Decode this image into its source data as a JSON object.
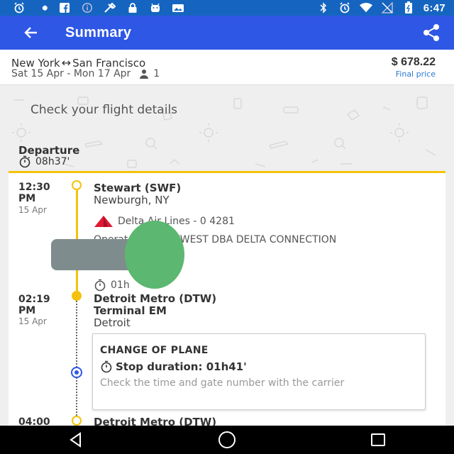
{
  "status_bar": {
    "time": "6:47",
    "left_icons": [
      "alarm-icon",
      "wrench-icon",
      "facebook-icon",
      "info-icon",
      "tools-icon",
      "lock-icon",
      "android-icon",
      "photo-icon"
    ],
    "right_icons": [
      "bluetooth-icon",
      "alarm-icon",
      "wifi-icon",
      "signal-off-icon",
      "battery-icon"
    ]
  },
  "app_bar": {
    "title": "Summary",
    "color": "#2f57e6"
  },
  "trip": {
    "origin": "New York",
    "destination": "San Francisco",
    "route_separator": "↔",
    "dates": "Sat 15 Apr - Mon 17 Apr",
    "passengers": "1",
    "price": "$ 678.22",
    "price_note": "Final price"
  },
  "content": {
    "check_title": "Check your flight details",
    "departure_label": "Departure",
    "departure_duration": "08h37'"
  },
  "segment1": {
    "dep_time_line1": "12:30",
    "dep_time_line2": "PM",
    "dep_date": "15 Apr",
    "dep_airport": "Stewart (SWF)",
    "dep_city": "Newburgh, NY",
    "airline": "Delta Air Lines - 0 4281",
    "operated_by": "Operated by: SKYWEST DBA DELTA CONNECTION",
    "duration": "01h",
    "arr_time_line1": "02:19",
    "arr_time_line2": "PM",
    "arr_date": "15 Apr",
    "arr_airport": "Detroit Metro (DTW)",
    "arr_terminal": "Terminal EM",
    "arr_city": "Detroit"
  },
  "stopover": {
    "title": "CHANGE OF PLANE",
    "duration": "Stop duration: 01h41'",
    "note": "Check the time and gate number with the carrier"
  },
  "segment2": {
    "dep_time_line1": "04:00",
    "dep_airport": "Detroit Metro (DTW)"
  },
  "colors": {
    "accent_yellow": "#f4c20d",
    "status_bar": "#1565c0",
    "link_blue": "#2a7ad5",
    "delta_red": "#e01933"
  }
}
